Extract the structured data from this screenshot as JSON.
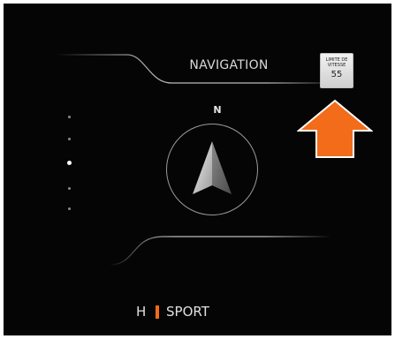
{
  "navigation": {
    "title": "NAVIGATION",
    "compass_heading": "N"
  },
  "speed_limit": {
    "caption": "LIMITE DE VITESSE",
    "value": "55"
  },
  "drive_mode": {
    "gear": "H",
    "mode": "SPORT"
  },
  "page_indicator": {
    "count": 5,
    "active_index": 2
  },
  "colors": {
    "background": "#050505",
    "accent_orange": "#f26c1a",
    "text": "#d9d9d9",
    "speed_sign": "#e6e6e6"
  },
  "icons": {
    "compass": "navigation-arrow-icon",
    "callout": "up-arrow-icon"
  }
}
